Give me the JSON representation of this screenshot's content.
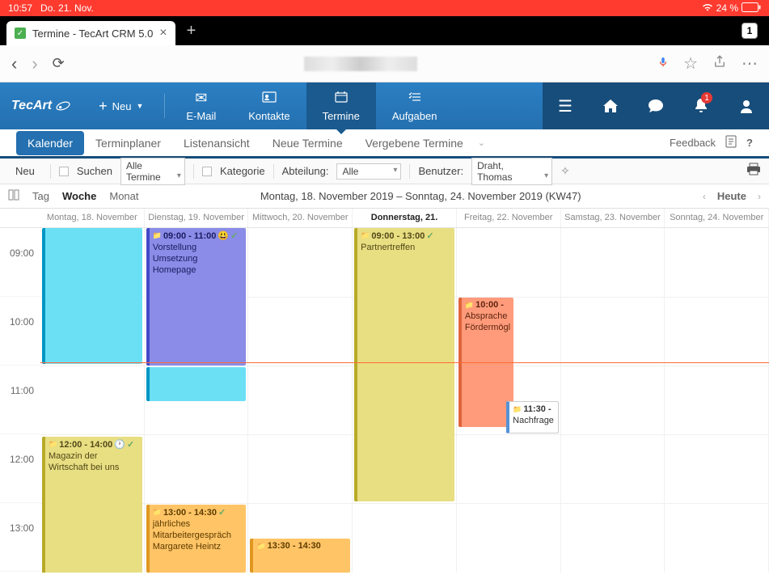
{
  "status": {
    "time": "10:57",
    "date": "Do. 21. Nov.",
    "battery": "24 %"
  },
  "tab": {
    "title": "Termine - TecArt CRM 5.0",
    "count": "1"
  },
  "appHeader": {
    "logo": "TecArt",
    "nav": {
      "neu": "Neu",
      "email": "E-Mail",
      "kontakte": "Kontakte",
      "termine": "Termine",
      "aufgaben": "Aufgaben"
    },
    "badge": "1"
  },
  "secNav": {
    "tabs": [
      "Kalender",
      "Terminplaner",
      "Listenansicht",
      "Neue Termine",
      "Vergebene Termine"
    ],
    "feedback": "Feedback",
    "help": "?"
  },
  "filter": {
    "neu": "Neu",
    "suchen": "Suchen",
    "termineSelect": "Alle Termine",
    "kategorie": "Kategorie",
    "abteilungLabel": "Abteilung:",
    "abteilungSelect": "Alle",
    "benutzerLabel": "Benutzer:",
    "benutzerSelect": "Draht, Thomas"
  },
  "view": {
    "modes": {
      "tag": "Tag",
      "woche": "Woche",
      "monat": "Monat"
    },
    "range": "Montag, 18. November 2019 – Sonntag, 24. November 2019 (KW47)",
    "heute": "Heute"
  },
  "days": [
    "Montag, 18. November",
    "Dienstag, 19. November",
    "Mittwoch, 20. November",
    "Donnerstag, 21.",
    "Freitag, 22. November",
    "Samstag, 23. November",
    "Sonntag, 24. November"
  ],
  "hours": [
    "09:00",
    "10:00",
    "11:00",
    "12:00",
    "13:00"
  ],
  "events": {
    "mon_block": {
      "time": "",
      "title": ""
    },
    "mon_mag": {
      "time": "12:00 - 14:00",
      "title": "Magazin der Wirtschaft bei uns"
    },
    "tue_hp": {
      "time": "09:00 - 11:00",
      "title": "Vorstellung Umsetzung Homepage"
    },
    "tue_mit": {
      "time": "13:00 - 14:30",
      "title": "jährliches Mitarbeitergespräch Margarete Heintz"
    },
    "wed_abs": {
      "time": "13:30 - 14:30",
      "title": ""
    },
    "thu_partner": {
      "time": "09:00 - 13:00",
      "title": "Partnertreffen"
    },
    "fri_abs": {
      "time": "10:00 -",
      "title": "Absprache Fördermögl"
    },
    "fri_nach": {
      "time": "11:30 -",
      "title": "Nachfrage"
    }
  }
}
